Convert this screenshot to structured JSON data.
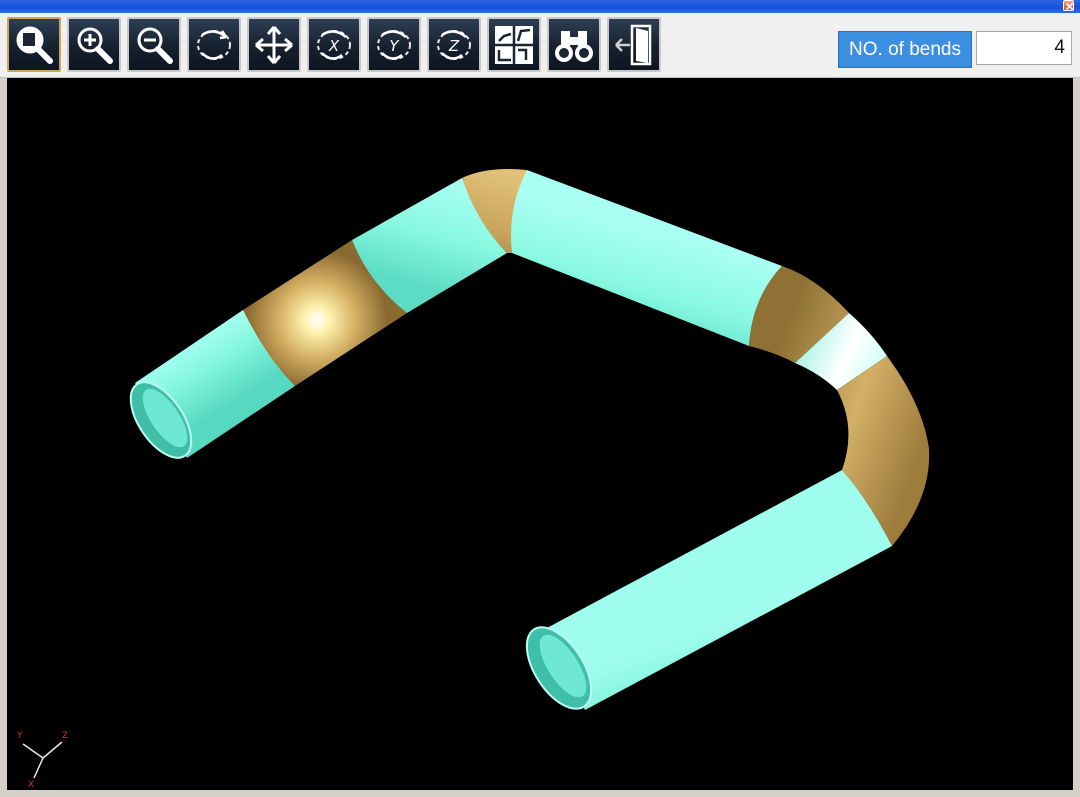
{
  "window": {
    "close_icon": "close-icon"
  },
  "toolbar": {
    "tools": [
      {
        "id": "zoom-fit",
        "icon": "zoom-fit-icon"
      },
      {
        "id": "zoom-in",
        "icon": "zoom-in-icon"
      },
      {
        "id": "zoom-out",
        "icon": "zoom-out-icon"
      },
      {
        "id": "rotate-free",
        "icon": "rotate-icon"
      },
      {
        "id": "pan",
        "icon": "pan-arrows-icon"
      },
      {
        "id": "rotate-x",
        "icon": "rotate-x-icon",
        "label": "X"
      },
      {
        "id": "rotate-y",
        "icon": "rotate-y-icon",
        "label": "Y"
      },
      {
        "id": "rotate-z",
        "icon": "rotate-z-icon",
        "label": "Z"
      },
      {
        "id": "views",
        "icon": "views-icon"
      },
      {
        "id": "inspect",
        "icon": "binoculars-icon"
      },
      {
        "id": "exit",
        "icon": "exit-door-icon"
      }
    ],
    "bends_label": "NO. of bends",
    "bends_value": "4"
  },
  "viewport": {
    "background": "#000000",
    "pipe_straight_color": "#7ff5dc",
    "pipe_bend_color": "#c9a55c",
    "highlight_color": "#ffffff",
    "axes": {
      "labels": [
        "Y",
        "Z",
        "X"
      ]
    }
  }
}
